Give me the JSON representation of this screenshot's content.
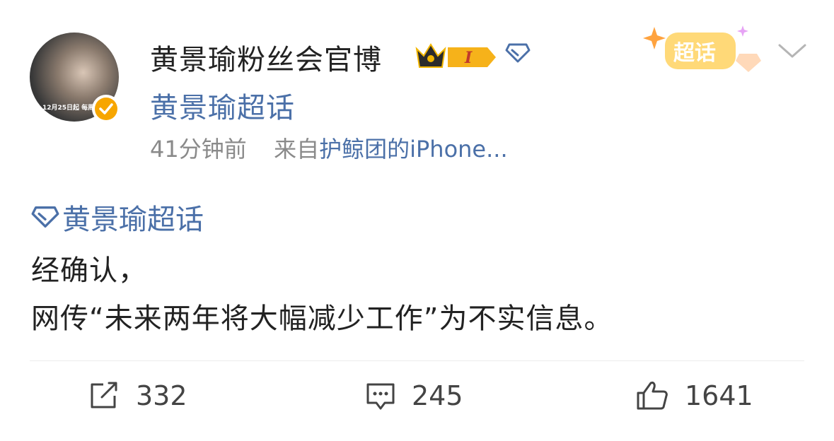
{
  "author": {
    "name": "黄景瑜粉丝会官博",
    "supertopic": "黄景瑜超话",
    "avatar_caption": "12月25日起  每周"
  },
  "meta": {
    "time": "41分钟前",
    "source_prefix": "来自",
    "device": "护鲸团的iPhone..."
  },
  "badge": {
    "label": "超话",
    "level": "I"
  },
  "post": {
    "topic": "黄景瑜超话",
    "lines": [
      "经确认，",
      "网传“未来两年将大幅减少工作”为不实信息。"
    ]
  },
  "actions": {
    "repost": "332",
    "comment": "245",
    "like": "1641"
  },
  "colors": {
    "link": "#4b70a8",
    "text": "#222222",
    "meta": "#8a8a8a",
    "verified": "#f7a600"
  }
}
